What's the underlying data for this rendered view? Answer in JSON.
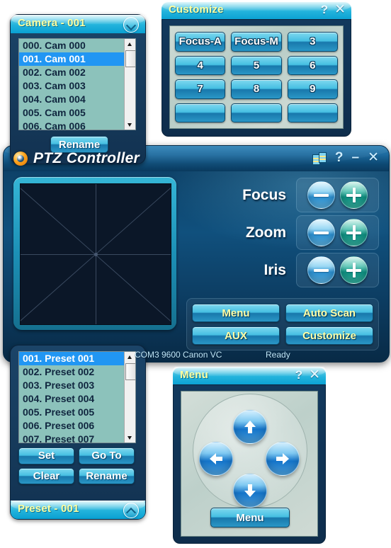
{
  "camera_window": {
    "title": "Camera - 001",
    "collapse_icon": "chevron-down-icon",
    "list": [
      {
        "label": "000. Cam 000",
        "selected": false
      },
      {
        "label": "001. Cam 001",
        "selected": true
      },
      {
        "label": "002. Cam 002",
        "selected": false
      },
      {
        "label": "003. Cam 003",
        "selected": false
      },
      {
        "label": "004. Cam 004",
        "selected": false
      },
      {
        "label": "005. Cam 005",
        "selected": false
      },
      {
        "label": "006. Cam 006",
        "selected": false
      }
    ],
    "rename_label": "Rename"
  },
  "customize_window": {
    "title": "Customize",
    "help_label": "?",
    "close_label": "✕",
    "buttons": [
      "Focus-A",
      "Focus-M",
      "3",
      "4",
      "5",
      "6",
      "7",
      "8",
      "9",
      "",
      "",
      ""
    ]
  },
  "ptz_window": {
    "title": "PTZ Controller",
    "logo_icon": "ptz-eye-logo-icon",
    "list_icon": "list-settings-icon",
    "help_label": "?",
    "minimize_label": "–",
    "close_label": "✕",
    "pad_name": "pan-tilt-pad",
    "controls": [
      {
        "label": "Focus",
        "minus": "−",
        "plus": "+"
      },
      {
        "label": "Zoom",
        "minus": "−",
        "plus": "+"
      },
      {
        "label": "Iris",
        "minus": "−",
        "plus": "+"
      }
    ],
    "action_buttons": [
      "Menu",
      "Auto Scan",
      "AUX",
      "Customize"
    ],
    "status": {
      "connection": "COM3 9600 Canon VC",
      "state": "Ready"
    }
  },
  "preset_window": {
    "title": "Preset - 001",
    "collapse_icon": "chevron-up-icon",
    "list": [
      {
        "label": "001. Preset 001",
        "selected": true
      },
      {
        "label": "002. Preset 002",
        "selected": false
      },
      {
        "label": "003. Preset 003",
        "selected": false
      },
      {
        "label": "004. Preset 004",
        "selected": false
      },
      {
        "label": "005. Preset 005",
        "selected": false
      },
      {
        "label": "006. Preset 006",
        "selected": false
      },
      {
        "label": "007. Preset 007",
        "selected": false
      }
    ],
    "buttons": [
      "Set",
      "Go To",
      "Clear",
      "Rename"
    ]
  },
  "menu_window": {
    "title": "Menu",
    "help_label": "?",
    "close_label": "✕",
    "up_icon": "arrow-up-icon",
    "down_icon": "arrow-down-icon",
    "left_icon": "arrow-left-icon",
    "right_icon": "arrow-right-icon",
    "menu_button_label": "Menu"
  },
  "colors": {
    "title_text": "#ffffa0",
    "titlebar_cyan": "#22b3dc",
    "panel_navy": "#123251",
    "list_bg": "#8cc2bb",
    "selection_blue": "#2196f3",
    "button_yellow_text": "#ffffa8",
    "plus_teal": "#0e8f80",
    "minus_blue": "#2b8fd0",
    "logo_orange": "#ffa41c",
    "status_text": "#bfe6f7"
  }
}
